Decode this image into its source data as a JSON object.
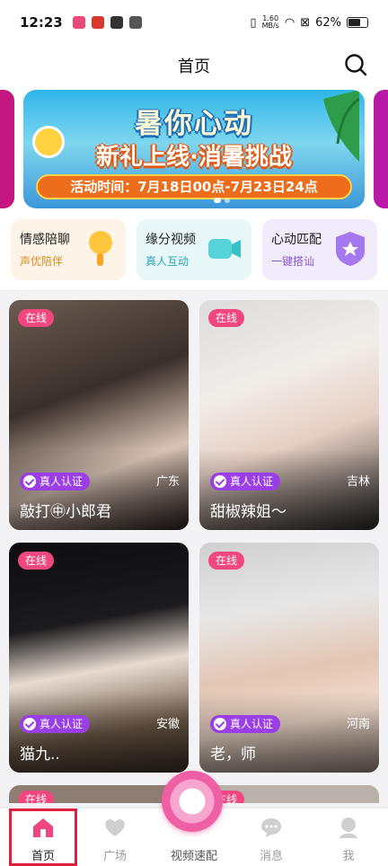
{
  "status": {
    "time": "12:23",
    "net_speed_value": "1.60",
    "net_speed_unit": "MB/s",
    "battery": "62%"
  },
  "header": {
    "title": "首页"
  },
  "banner": {
    "headline": "暑你心动",
    "subline": "新礼上线·消暑挑战",
    "time_text": "活动时间：7月18日00点-7月23日24点"
  },
  "features": [
    {
      "title": "情感陪聊",
      "subtitle": "声优陪伴",
      "icon": "microphone-icon"
    },
    {
      "title": "缘分视频",
      "subtitle": "真人互动",
      "icon": "video-camera-icon"
    },
    {
      "title": "心动匹配",
      "subtitle": "一键搭讪",
      "icon": "star-shield-icon"
    }
  ],
  "cards": [
    {
      "status": "在线",
      "verified": "真人认证",
      "region": "广东",
      "nickname": "敲打㊥小郎君"
    },
    {
      "status": "在线",
      "verified": "真人认证",
      "region": "吉林",
      "nickname": "甜椒辣姐～"
    },
    {
      "status": "在线",
      "verified": "真人认证",
      "region": "安徽",
      "nickname": "猫九.."
    },
    {
      "status": "在线",
      "verified": "真人认证",
      "region": "河南",
      "nickname": "老，师"
    },
    {
      "status": "在线"
    },
    {
      "status": "在线"
    }
  ],
  "tabs": [
    {
      "label": "首页",
      "icon": "home-icon"
    },
    {
      "label": "广场",
      "icon": "heart-chat-icon"
    },
    {
      "label": "视频速配",
      "icon": "video-match-icon"
    },
    {
      "label": "消息",
      "icon": "message-icon"
    },
    {
      "label": "我",
      "icon": "profile-icon"
    }
  ],
  "colors": {
    "accent": "#f0477f",
    "verify": "#9a3ee6",
    "tab_highlight": "#e0203a"
  }
}
